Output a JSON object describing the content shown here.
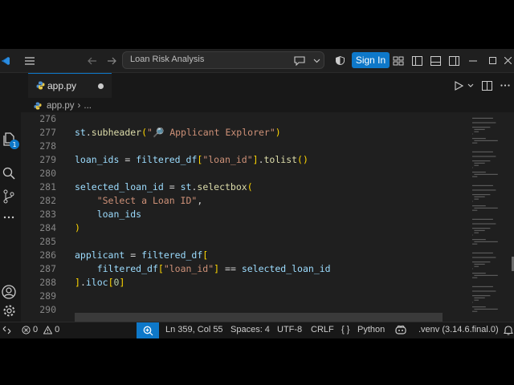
{
  "titlebar": {
    "search_text": "Loan Risk Analysis",
    "sign_in_label": "Sign In"
  },
  "activity": {
    "explorer_badge": "1"
  },
  "tabs": [
    {
      "label": "app.py",
      "modified": true
    }
  ],
  "breadcrumb": {
    "file": "app.py",
    "separator": "›",
    "more": "..."
  },
  "editor": {
    "language": "python",
    "lines": [
      {
        "number": "276",
        "text": ""
      },
      {
        "number": "277",
        "text": "st.subheader(\"🔎 Applicant Explorer\")"
      },
      {
        "number": "278",
        "text": ""
      },
      {
        "number": "279",
        "text": "loan_ids = filtered_df[\"loan_id\"].tolist()"
      },
      {
        "number": "280",
        "text": ""
      },
      {
        "number": "281",
        "text": "selected_loan_id = st.selectbox("
      },
      {
        "number": "282",
        "text": "    \"Select a Loan ID\","
      },
      {
        "number": "283",
        "text": "    loan_ids"
      },
      {
        "number": "284",
        "text": ")"
      },
      {
        "number": "285",
        "text": ""
      },
      {
        "number": "286",
        "text": "applicant = filtered_df["
      },
      {
        "number": "287",
        "text": "    filtered_df[\"loan_id\"] == selected_loan_id"
      },
      {
        "number": "288",
        "text": "].iloc[0]"
      },
      {
        "number": "289",
        "text": ""
      },
      {
        "number": "290",
        "text": ""
      }
    ]
  },
  "statusbar": {
    "errors": "0",
    "warnings": "0",
    "cursor": "Ln 359, Col 55",
    "spaces": "Spaces: 4",
    "encoding": "UTF-8",
    "eol": "CRLF",
    "language": "Python",
    "language_braces": "{ }",
    "interpreter": ".venv (3.14.6.final.0)"
  },
  "colors": {
    "accent": "#0e78c9",
    "editor_bg": "#1f1f1f",
    "chrome_bg": "#181818"
  }
}
